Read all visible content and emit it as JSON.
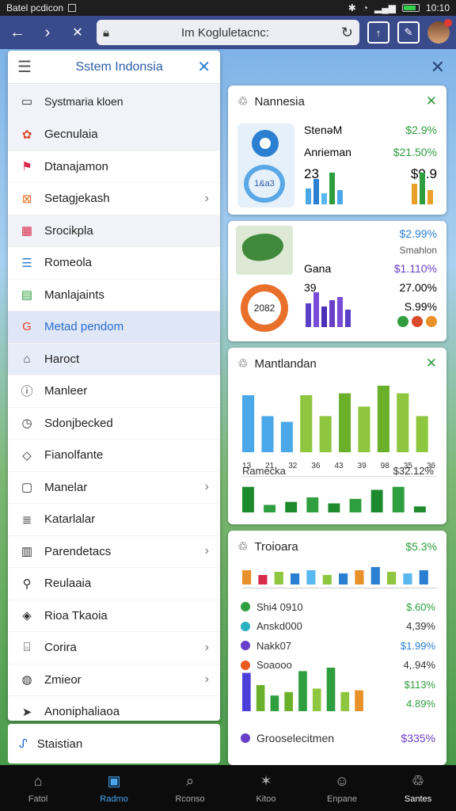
{
  "status": {
    "left_text": "Batel pcdicon",
    "time": "10:10",
    "battery_level": 0.85
  },
  "browser": {
    "url": "Im Kogluletacnc:"
  },
  "drawer": {
    "title": "Sstem Indonsia",
    "search_text": "Systmaria kloen",
    "items": [
      {
        "label": "Gecnulaia",
        "icon": "plant-icon",
        "chevron": false
      },
      {
        "label": "Dtanajamon",
        "icon": "flag-icon",
        "chevron": false
      },
      {
        "label": "Setagjekash",
        "icon": "close-square-icon",
        "chevron": true
      },
      {
        "label": "Srocikpla",
        "icon": "calendar-icon",
        "chevron": false
      },
      {
        "label": "Romeola",
        "icon": "list-icon",
        "chevron": false
      },
      {
        "label": "Manlajaints",
        "icon": "message-icon",
        "chevron": false
      },
      {
        "label": "Metad pendom",
        "icon": "google-icon",
        "chevron": false
      },
      {
        "label": "Haroct",
        "icon": "home-icon",
        "chevron": false
      },
      {
        "label": "Manleer",
        "icon": "info-circle-icon",
        "chevron": false
      },
      {
        "label": "Sdonjbecked",
        "icon": "clock-icon",
        "chevron": false
      },
      {
        "label": "Fianolfante",
        "icon": "tag-icon",
        "chevron": false
      },
      {
        "label": "Manelar",
        "icon": "square-icon",
        "chevron": true
      },
      {
        "label": "Katarlalar",
        "icon": "document-icon",
        "chevron": false
      },
      {
        "label": "Parendetacs",
        "icon": "book-icon",
        "chevron": true
      },
      {
        "label": "Reulaaia",
        "icon": "user-icon",
        "chevron": false
      },
      {
        "label": "Rioa Tkaoia",
        "icon": "tag-outline-icon",
        "chevron": false
      },
      {
        "label": "Corira",
        "icon": "building-icon",
        "chevron": true
      },
      {
        "label": "Zmieor",
        "icon": "globe-icon",
        "chevron": true
      },
      {
        "label": "Anoniphaliaoa",
        "icon": "send-icon",
        "chevron": false
      }
    ],
    "footer_label": "Staistian"
  },
  "card1": {
    "title": "Nannesia",
    "rows": [
      {
        "label": "StenəM",
        "value": "$2.9%"
      },
      {
        "label": "Anrieman",
        "value": "$21.50%"
      }
    ],
    "big_left": "23",
    "big_right": "$9.9",
    "donut_label": "1&a3",
    "bars_left": [
      20,
      32,
      14,
      40,
      18
    ],
    "bars_right": [
      26,
      40,
      18
    ]
  },
  "card2": {
    "top_value": "$2.99%",
    "sub_label": "Smahlon",
    "row_label": "Gana",
    "row_value": "$1.110%",
    "big_left": "39",
    "big_right": "27.00%",
    "right_value": "S.99%",
    "donut_label": "2082",
    "bars": [
      30,
      44,
      26,
      34,
      38,
      22
    ]
  },
  "card3": {
    "title": "Mantlandan",
    "x_ticks": [
      "13",
      "21",
      "32",
      "36",
      "43",
      "39",
      "98",
      "35",
      "36"
    ],
    "bars": [
      60,
      38,
      32,
      60,
      38,
      62,
      48,
      70,
      62,
      38
    ],
    "row_label": "Ramecka",
    "row_value": "$32.12%",
    "bars_bottom": [
      34,
      10,
      14,
      20,
      12,
      18,
      30,
      34,
      8
    ]
  },
  "card4": {
    "title": "Troioara",
    "title_value": "$5.3%",
    "bars_top": [
      18,
      12,
      16,
      14,
      18,
      12,
      14,
      18,
      22,
      16,
      14,
      18
    ],
    "rows": [
      {
        "label": "Shi4 0910",
        "value": "$.60%",
        "color": "#2e9e3e"
      },
      {
        "label": "Anskd000",
        "value": "4,39%",
        "color": "#2ab0c0"
      },
      {
        "label": "Nakk07",
        "value": "$1.99%",
        "color": "#6a3fc8"
      },
      {
        "label": "Soaooo",
        "value": "4,.94%",
        "color": "#e85a20"
      },
      {
        "label": "",
        "value": "$113%",
        "color": ""
      },
      {
        "label": "",
        "value": "4.89%",
        "color": ""
      }
    ],
    "bars_bottom": [
      44,
      30,
      18,
      22,
      46,
      26,
      50,
      22,
      24
    ],
    "footer_label": "Grooselecitmen",
    "footer_value": "$335%"
  },
  "bottom": {
    "tabs": [
      {
        "label": "Fatol",
        "icon": "home-icon"
      },
      {
        "label": "Radmo",
        "icon": "shop-icon"
      },
      {
        "label": "Rconso",
        "icon": "search-icon"
      },
      {
        "label": "Kitoo",
        "icon": "star-icon"
      },
      {
        "label": "Enpane",
        "icon": "profile-icon"
      },
      {
        "label": "Santes",
        "icon": "recycle-icon"
      }
    ]
  }
}
